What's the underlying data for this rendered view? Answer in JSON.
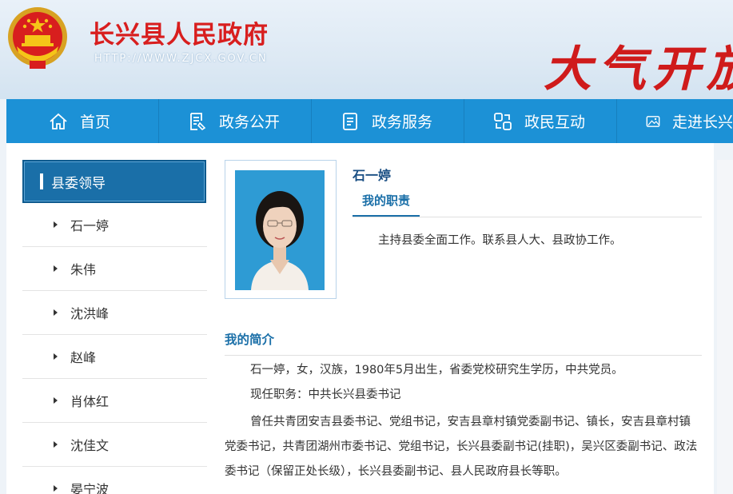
{
  "header": {
    "site_title": "长兴县人民政府",
    "site_url": "HTTP://WWW.ZJCX.GOV.CN",
    "slogan": "大气开放"
  },
  "nav": [
    {
      "label": "首页",
      "icon": "home-icon"
    },
    {
      "label": "政务公开",
      "icon": "document-icon"
    },
    {
      "label": "政务服务",
      "icon": "service-icon"
    },
    {
      "label": "政民互动",
      "icon": "interaction-icon"
    },
    {
      "label": "走进长兴",
      "icon": "picture-icon"
    }
  ],
  "sidebar": {
    "title": "县委领导",
    "items": [
      "石一婷",
      "朱伟",
      "沈洪峰",
      "赵峰",
      "肖体红",
      "沈佳文",
      "晏宁波"
    ]
  },
  "profile": {
    "name": "石一婷",
    "duty_tab": "我的职责",
    "duty_text": "主持县委全面工作。联系县人大、县政协工作。",
    "bio_title": "我的简介",
    "bio": [
      "石一婷，女，汉族，1980年5月出生，省委党校研究生学历，中共党员。",
      "现任职务：中共长兴县委书记",
      "曾任共青团安吉县委书记、党组书记，安吉县章村镇党委副书记、镇长，安吉县章村镇党委书记，共青团湖州市委书记、党组书记，长兴县委副书记(挂职)，吴兴区委副书记、政法委书记（保留正处长级），长兴县委副书记、县人民政府县长等职。"
    ]
  },
  "colors": {
    "nav_bg": "#1c91d6",
    "title_red": "#d81e1e",
    "accent_blue": "#1a6fa8"
  }
}
